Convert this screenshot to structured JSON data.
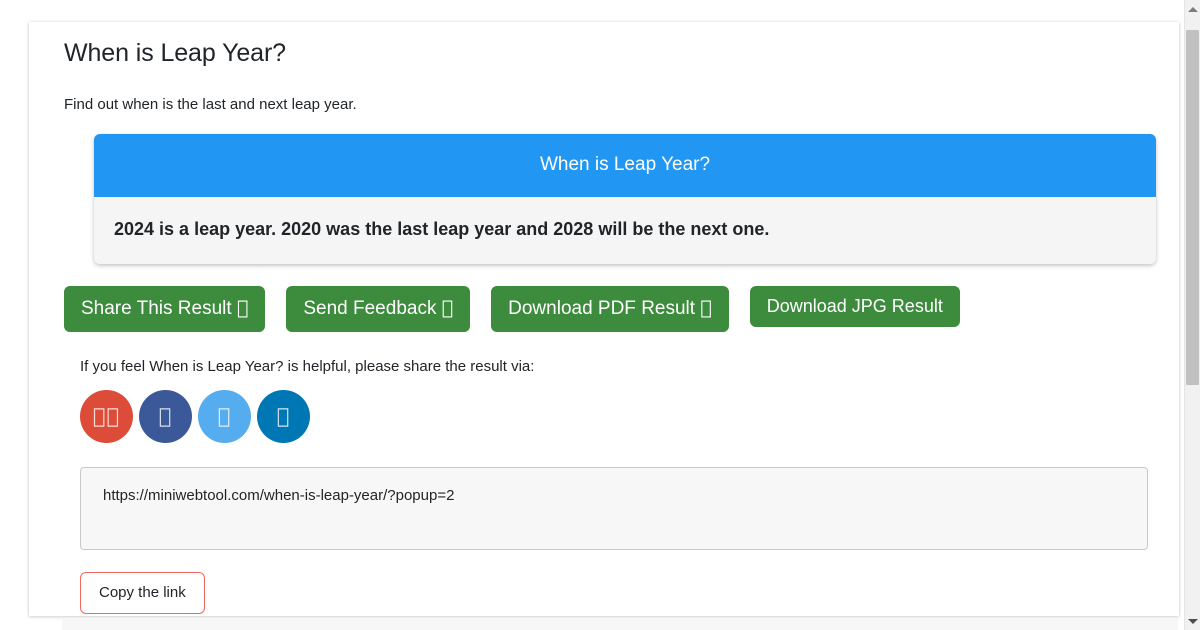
{
  "page": {
    "title": "When is Leap Year?",
    "subtitle": "Find out when is the last and next leap year."
  },
  "result_panel": {
    "header": "When is Leap Year?",
    "body": "2024 is a leap year. 2020 was the last leap year and 2028 will be the next one.",
    "header_bg": "#2196f3",
    "body_bg": "#f5f5f5"
  },
  "actions": {
    "share_label": "Share This Result",
    "share_icon": "",
    "feedback_label": "Send Feedback",
    "feedback_icon": "",
    "pdf_label": "Download PDF Result",
    "pdf_icon": "",
    "jpg_label": "Download JPG Result",
    "button_color": "#3d8b3d"
  },
  "share": {
    "prompt": "If you feel When is Leap Year? is helpful, please share the result via:",
    "networks": [
      {
        "name": "email",
        "glyph": "",
        "color": "#dd4b39"
      },
      {
        "name": "facebook",
        "glyph": "",
        "color": "#3b5998"
      },
      {
        "name": "twitter",
        "glyph": "",
        "color": "#55acee"
      },
      {
        "name": "linkedin",
        "glyph": "",
        "color": "#0077b5"
      }
    ]
  },
  "link": {
    "url": "https://miniwebtool.com/when-is-leap-year/?popup=2",
    "copy_label": "Copy the link"
  },
  "scrollbar": {
    "up_arrow": "▲",
    "down_arrow": "▼"
  }
}
